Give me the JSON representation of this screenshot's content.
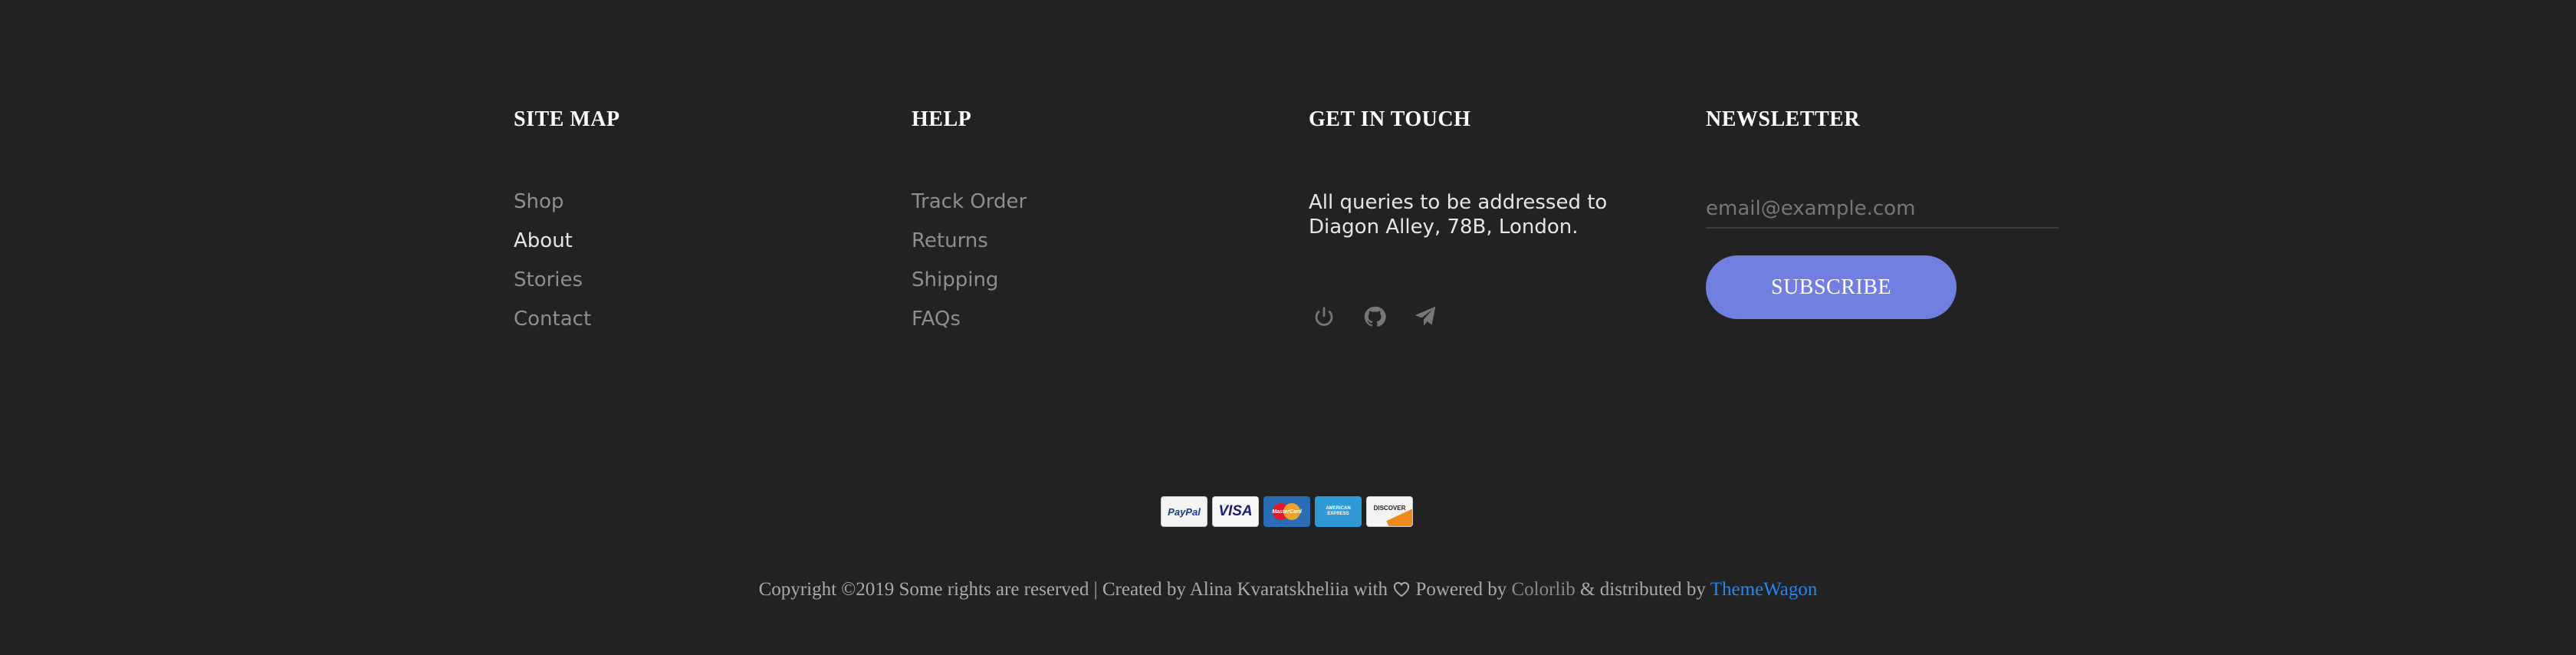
{
  "site_map": {
    "heading": "SITE MAP",
    "links": [
      "Shop",
      "About",
      "Stories",
      "Contact"
    ]
  },
  "help": {
    "heading": "HELP",
    "links": [
      "Track Order",
      "Returns",
      "Shipping",
      "FAQs"
    ]
  },
  "contact": {
    "heading": "GET IN TOUCH",
    "text": "All queries to be addressed to Diagon Alley, 78B, London.",
    "social_icons": [
      "power-icon",
      "github-icon",
      "send-icon"
    ]
  },
  "newsletter": {
    "heading": "NEWSLETTER",
    "placeholder": "email@example.com",
    "button_label": "SUBSCRIBE"
  },
  "payments": {
    "paypal": "PayPal",
    "visa": "VISA",
    "mastercard": "MasterCard",
    "amex": "AMERICAN EXPRESS",
    "discover": "DISCOVER"
  },
  "copyright": {
    "prefix": "Copyright ©2019 Some rights are reserved | Created by Alina Kvaratskheliia with",
    "powered": "Powered by",
    "colorlib": "Colorlib",
    "distributed": "& distributed by",
    "themewagon": "ThemeWagon"
  },
  "colors": {
    "background": "#222222",
    "accent": "#717fe0",
    "link_blue": "#1e88f7",
    "muted_text": "#8f8f8f"
  }
}
